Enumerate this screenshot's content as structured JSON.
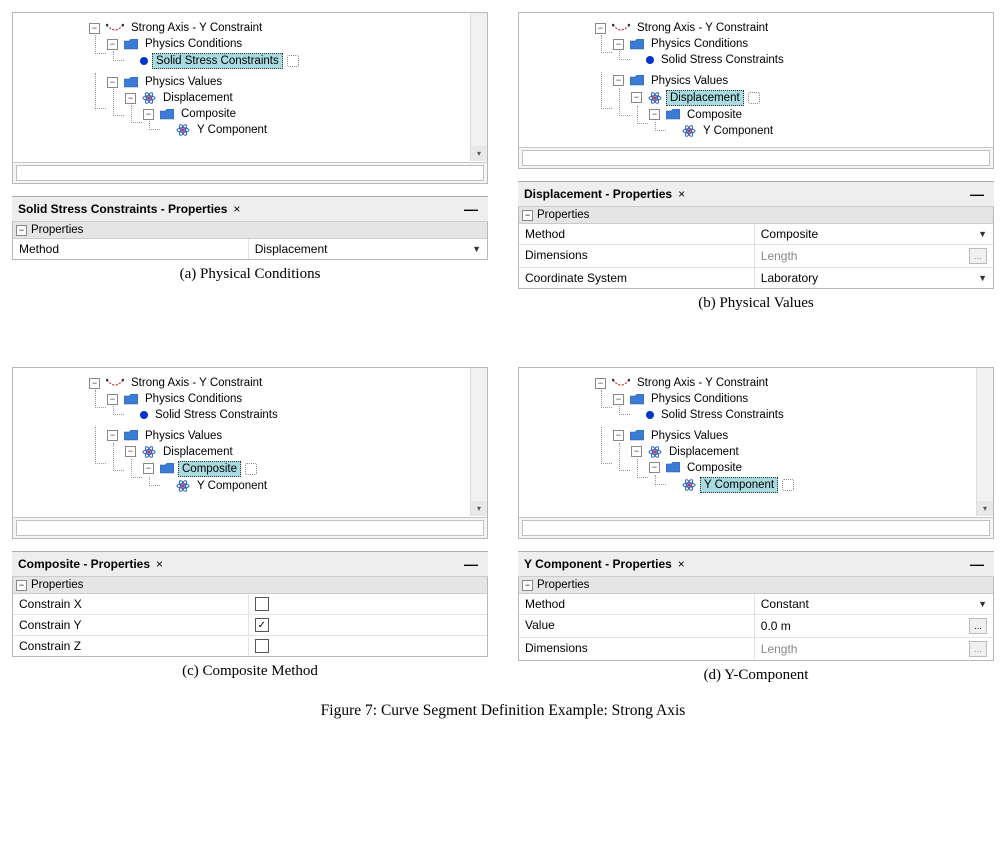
{
  "figure": {
    "label": "Figure 7:",
    "text": "Curve Segment Definition Example: Strong Axis"
  },
  "tree": {
    "root": "Strong Axis - Y Constraint",
    "physCond": "Physics Conditions",
    "solidStress": "Solid Stress Constraints",
    "physVal": "Physics Values",
    "displacement": "Displacement",
    "composite": "Composite",
    "ycomp": "Y Component"
  },
  "panels": {
    "a": {
      "caption": "(a) Physical Conditions",
      "propsTitle": "Solid Stress Constraints - Properties",
      "rows": [
        {
          "k": "Method",
          "v": "Displacement",
          "dd": true
        }
      ]
    },
    "b": {
      "caption": "(b) Physical Values",
      "propsTitle": "Displacement - Properties",
      "rows": [
        {
          "k": "Method",
          "v": "Composite",
          "dd": true
        },
        {
          "k": "Dimensions",
          "v": "Length",
          "grey": true,
          "more": true
        },
        {
          "k": "Coordinate System",
          "v": "Laboratory",
          "dd": true
        }
      ]
    },
    "c": {
      "caption": "(c) Composite Method",
      "propsTitle": "Composite - Properties",
      "rows": [
        {
          "k": "Constrain X",
          "check": false
        },
        {
          "k": "Constrain Y",
          "check": true
        },
        {
          "k": "Constrain Z",
          "check": false
        }
      ]
    },
    "d": {
      "caption": "(d) Y-Component",
      "propsTitle": "Y Component - Properties",
      "rows": [
        {
          "k": "Method",
          "v": "Constant",
          "dd": true
        },
        {
          "k": "Value",
          "v": "0.0 m",
          "more": true
        },
        {
          "k": "Dimensions",
          "v": "Length",
          "grey": true,
          "more": true
        }
      ]
    }
  },
  "ui": {
    "propertiesGroup": "Properties"
  }
}
